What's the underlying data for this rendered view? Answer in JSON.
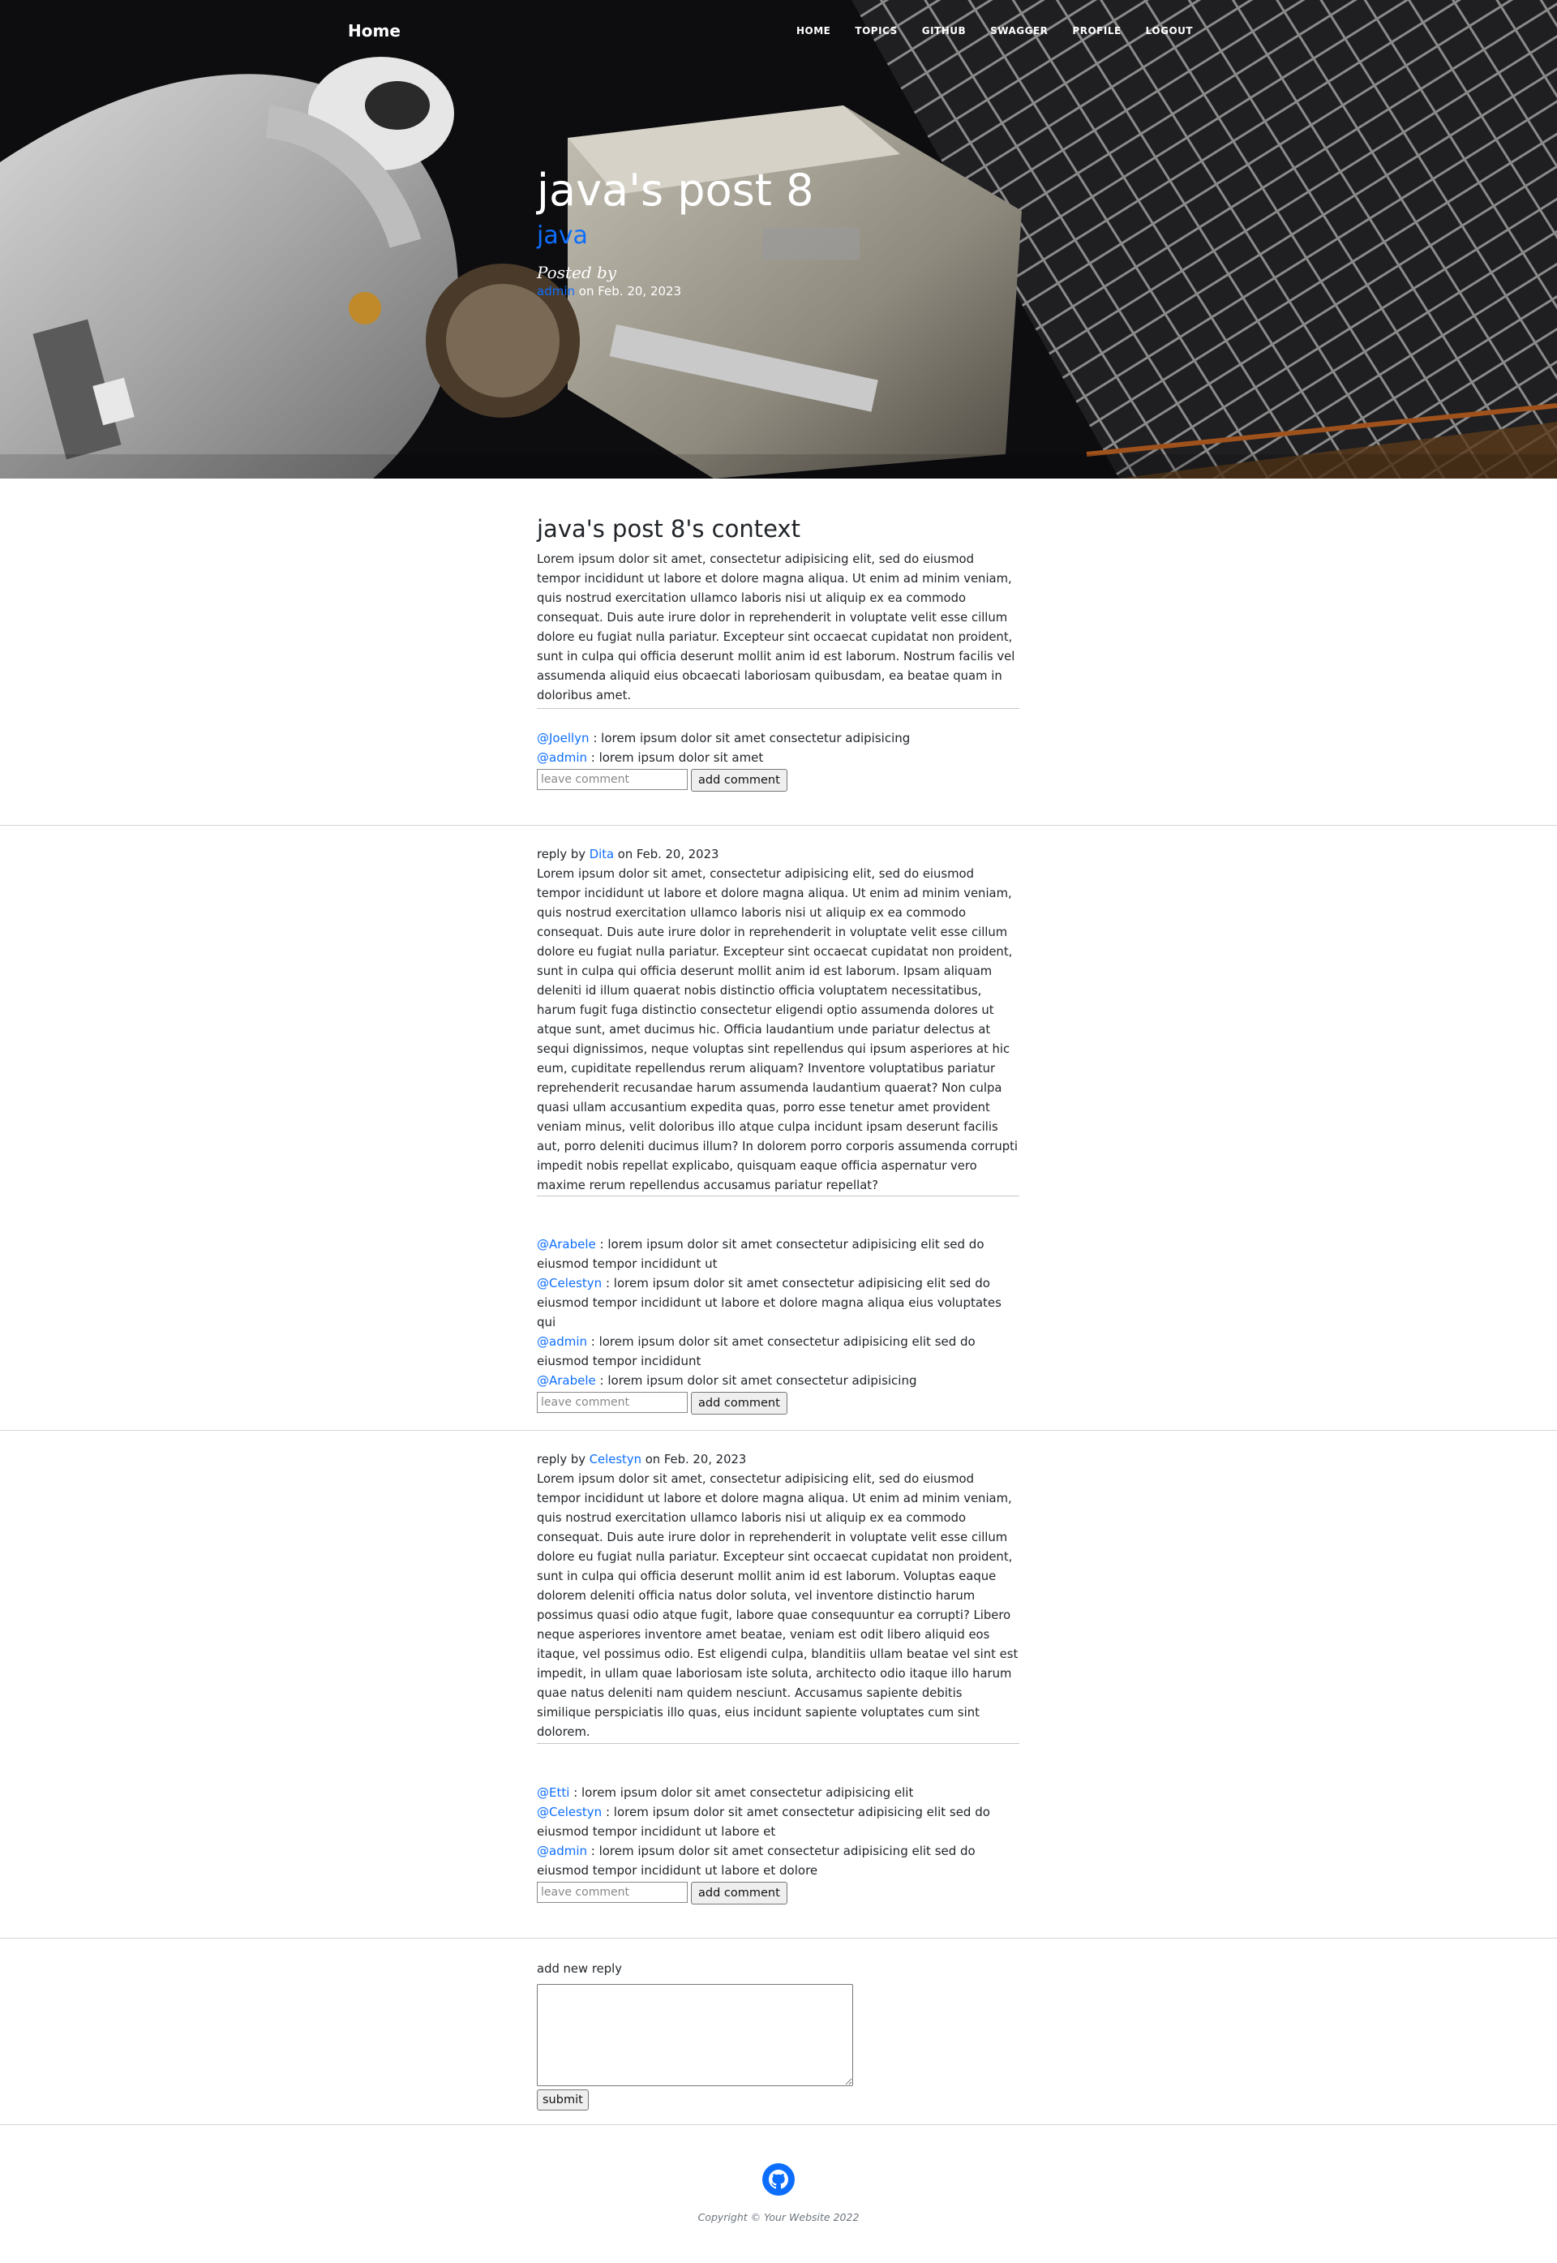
{
  "nav": {
    "brand": "Home",
    "links": [
      "HOME",
      "TOPICS",
      "GITHUB",
      "SWAGGER",
      "PROFILE",
      "LOGOUT"
    ]
  },
  "post": {
    "title": "java's post 8",
    "topic": "java",
    "posted_by": "Posted by",
    "author": "admin",
    "date": "on Feb. 20, 2023"
  },
  "context": {
    "title": "java's post 8's context",
    "text": "Lorem ipsum dolor sit amet, consectetur adipisicing elit, sed do eiusmod tempor incididunt ut labore et dolore magna aliqua. Ut enim ad minim veniam, quis nostrud exercitation ullamco laboris nisi ut aliquip ex ea commodo consequat. Duis aute irure dolor in reprehenderit in voluptate velit esse cillum dolore eu fugiat nulla pariatur. Excepteur sint occaecat cupidatat non proident, sunt in culpa qui officia deserunt mollit anim id est laborum. Nostrum facilis vel assumenda aliquid eius obcaecati laboriosam quibusdam, ea beatae quam in doloribus amet.",
    "comments": [
      {
        "user": "@Joellyn",
        "text": " : lorem ipsum dolor sit amet consectetur adipisicing"
      },
      {
        "user": "@admin",
        "text": " : lorem ipsum dolor sit amet"
      }
    ]
  },
  "comment_form": {
    "placeholder": "leave comment",
    "button": "add comment"
  },
  "replies": [
    {
      "prefix": "reply by ",
      "user": "Dita",
      "date": " on Feb. 20, 2023",
      "text": "Lorem ipsum dolor sit amet, consectetur adipisicing elit, sed do eiusmod tempor incididunt ut labore et dolore magna aliqua. Ut enim ad minim veniam, quis nostrud exercitation ullamco laboris nisi ut aliquip ex ea commodo consequat. Duis aute irure dolor in reprehenderit in voluptate velit esse cillum dolore eu fugiat nulla pariatur. Excepteur sint occaecat cupidatat non proident, sunt in culpa qui officia deserunt mollit anim id est laborum. Ipsam aliquam deleniti id illum quaerat nobis distinctio officia voluptatem necessitatibus, harum fugit fuga distinctio consectetur eligendi optio assumenda dolores ut atque sunt, amet ducimus hic. Officia laudantium unde pariatur delectus at sequi dignissimos, neque voluptas sint repellendus qui ipsum asperiores at hic eum, cupiditate repellendus rerum aliquam? Inventore voluptatibus pariatur reprehenderit recusandae harum assumenda laudantium quaerat? Non culpa quasi ullam accusantium expedita quas, porro esse tenetur amet provident veniam minus, velit doloribus illo atque culpa incidunt ipsam deserunt facilis aut, porro deleniti ducimus illum? In dolorem porro corporis assumenda corrupti impedit nobis repellat explicabo, quisquam eaque officia aspernatur vero maxime rerum repellendus accusamus pariatur repellat?",
      "comments": [
        {
          "user": "@Arabele",
          "text": " : lorem ipsum dolor sit amet consectetur adipisicing elit sed do eiusmod tempor incididunt ut"
        },
        {
          "user": "@Celestyn",
          "text": " : lorem ipsum dolor sit amet consectetur adipisicing elit sed do eiusmod tempor incididunt ut labore et dolore magna aliqua eius voluptates qui"
        },
        {
          "user": "@admin",
          "text": " : lorem ipsum dolor sit amet consectetur adipisicing elit sed do eiusmod tempor incididunt"
        },
        {
          "user": "@Arabele",
          "text": " : lorem ipsum dolor sit amet consectetur adipisicing"
        }
      ]
    },
    {
      "prefix": "reply by ",
      "user": "Celestyn",
      "date": " on Feb. 20, 2023",
      "text": "Lorem ipsum dolor sit amet, consectetur adipisicing elit, sed do eiusmod tempor incididunt ut labore et dolore magna aliqua. Ut enim ad minim veniam, quis nostrud exercitation ullamco laboris nisi ut aliquip ex ea commodo consequat. Duis aute irure dolor in reprehenderit in voluptate velit esse cillum dolore eu fugiat nulla pariatur. Excepteur sint occaecat cupidatat non proident, sunt in culpa qui officia deserunt mollit anim id est laborum. Voluptas eaque dolorem deleniti officia natus dolor soluta, vel inventore distinctio harum possimus quasi odio atque fugit, labore quae consequuntur ea corrupti? Libero neque asperiores inventore amet beatae, veniam est odit libero aliquid eos itaque, vel possimus odio. Est eligendi culpa, blanditiis ullam beatae vel sint est impedit, in ullam quae laboriosam iste soluta, architecto odio itaque illo harum quae natus deleniti nam quidem nesciunt. Accusamus sapiente debitis similique perspiciatis illo quas, eius incidunt sapiente voluptates cum sint dolorem.",
      "comments": [
        {
          "user": "@Etti",
          "text": " : lorem ipsum dolor sit amet consectetur adipisicing elit"
        },
        {
          "user": "@Celestyn",
          "text": " : lorem ipsum dolor sit amet consectetur adipisicing elit sed do eiusmod tempor incididunt ut labore et"
        },
        {
          "user": "@admin",
          "text": " : lorem ipsum dolor sit amet consectetur adipisicing elit sed do eiusmod tempor incididunt ut labore et dolore"
        }
      ]
    }
  ],
  "new_reply": {
    "label": "add new reply",
    "submit": "submit"
  },
  "footer": {
    "icon": "github-icon",
    "copyright": "Copyright © Your Website 2022"
  },
  "colors": {
    "link": "#0d6efd",
    "hero_bg": "#0d0d10"
  }
}
